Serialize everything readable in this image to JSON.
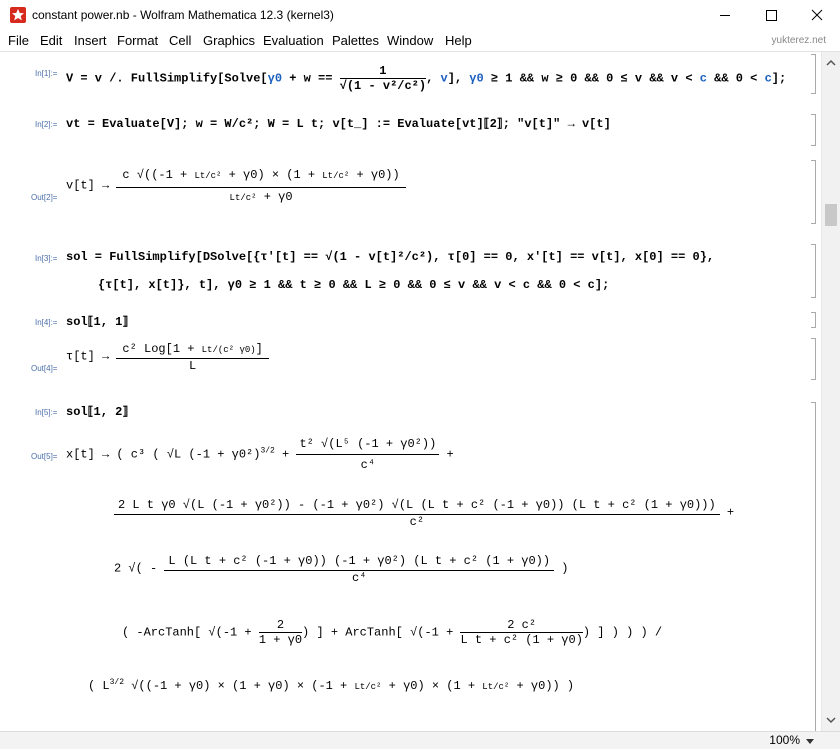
{
  "window": {
    "title": "constant power.nb - Wolfram Mathematica 12.3 (kernel3)",
    "brand": "yukterez.net",
    "zoom": "100%"
  },
  "menu": [
    "File",
    "Edit",
    "Insert",
    "Format",
    "Cell",
    "Graphics",
    "Evaluation",
    "Palettes",
    "Window",
    "Help"
  ],
  "cells": {
    "in1": {
      "label": "In[1]:=",
      "code": "V = v /. FullSimplify[Solve[γ0 + w == 1/√(1 - v²/c²), v], γ0 ≥ 1 && w ≥ 0 && 0 ≤ v && v < c && 0 < c];"
    },
    "in2": {
      "label": "In[2]:=",
      "code": "vt = Evaluate[V]; w = W/c²; W = L t; v[t_] := Evaluate[vt]⟦2⟧; \"v[t]\" → v[t]"
    },
    "out2": {
      "label": "Out[2]=",
      "code": "v[t] → c √((-1 + Lt/c² + γ0) × (1 + Lt/c² + γ0)) / (Lt/c² + γ0)"
    },
    "in3": {
      "label": "In[3]:=",
      "line1": "sol = FullSimplify[DSolve[{τ'[t] == √(1 - v[t]²/c²), τ[0] == 0, x'[t] == v[t], x[0] == 0},",
      "line2": "{τ[t], x[t]}, t], γ0 ≥ 1 && t ≥ 0 && L ≥ 0 && 0 ≤ v && v < c && 0 < c];"
    },
    "in4": {
      "label": "In[4]:=",
      "code": "sol⟦1, 1⟧"
    },
    "out4": {
      "label": "Out[4]=",
      "code": "τ[t] → c² Log[1 + Lt/(c² γ0)] / L"
    },
    "in5": {
      "label": "In[5]:=",
      "code": "sol⟦1, 2⟧"
    },
    "out5": {
      "label": "Out[5]=",
      "code": "x[t] → (c³ (√L (-1 + γ0²)^(3/2) + t² √(L⁵ (-1 + γ0²))/c⁴ + ...)) / (L^(3/2) √(...))"
    }
  }
}
